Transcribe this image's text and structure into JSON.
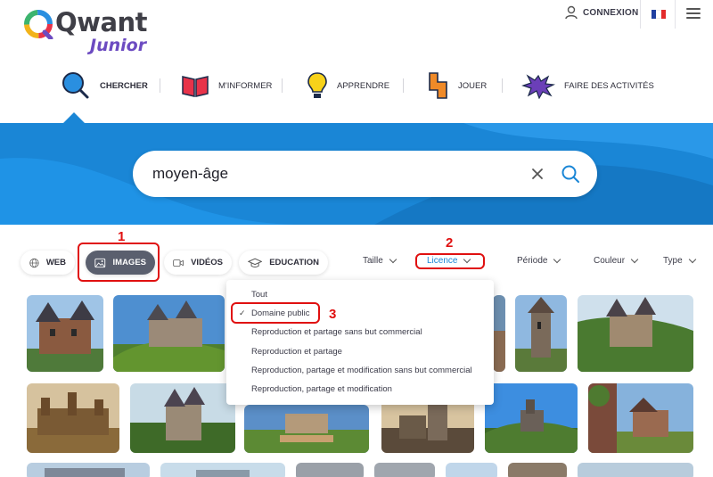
{
  "header": {
    "logo_word": "Qwant",
    "logo_sub": "Junior",
    "connexion_label": "CONNEXION",
    "language_flag": "fr-flag-icon",
    "menu_icon": "hamburger-icon"
  },
  "nav": {
    "items": [
      {
        "label": "CHERCHER",
        "icon": "magnifier-icon",
        "active": true
      },
      {
        "label": "M'INFORMER",
        "icon": "book-icon",
        "active": false
      },
      {
        "label": "APPRENDRE",
        "icon": "lightbulb-icon",
        "active": false
      },
      {
        "label": "JOUER",
        "icon": "puzzle-block-icon",
        "active": false
      },
      {
        "label": "FAIRE DES ACTIVITÉS",
        "icon": "paint-splash-icon",
        "active": false
      }
    ]
  },
  "search": {
    "value": "moyen-âge",
    "clear_icon": "close-icon",
    "submit_icon": "search-icon"
  },
  "tabs": [
    {
      "label": "WEB",
      "icon": "globe-icon",
      "active": false
    },
    {
      "label": "IMAGES",
      "icon": "image-icon",
      "active": true
    },
    {
      "label": "VIDÉOS",
      "icon": "video-icon",
      "active": false
    },
    {
      "label": "EDUCATION",
      "icon": "graduation-cap-icon",
      "active": false
    }
  ],
  "filters": {
    "taille": "Taille",
    "licence": "Licence",
    "periode": "Période",
    "couleur": "Couleur",
    "type": "Type"
  },
  "licence_menu": {
    "options": [
      "Tout",
      "Domaine public",
      "Reproduction et partage sans but commercial",
      "Reproduction et partage",
      "Reproduction, partage et modification sans but commercial",
      "Reproduction, partage et modification"
    ],
    "selected_index": 1
  },
  "annotations": {
    "marker_1": "1",
    "marker_2": "2",
    "marker_3": "3",
    "color": "#e01010"
  },
  "colors": {
    "brand_blue": "#1a86d6",
    "logo_purple": "#6c4bc1",
    "active_tab": "#5a5f6e"
  }
}
